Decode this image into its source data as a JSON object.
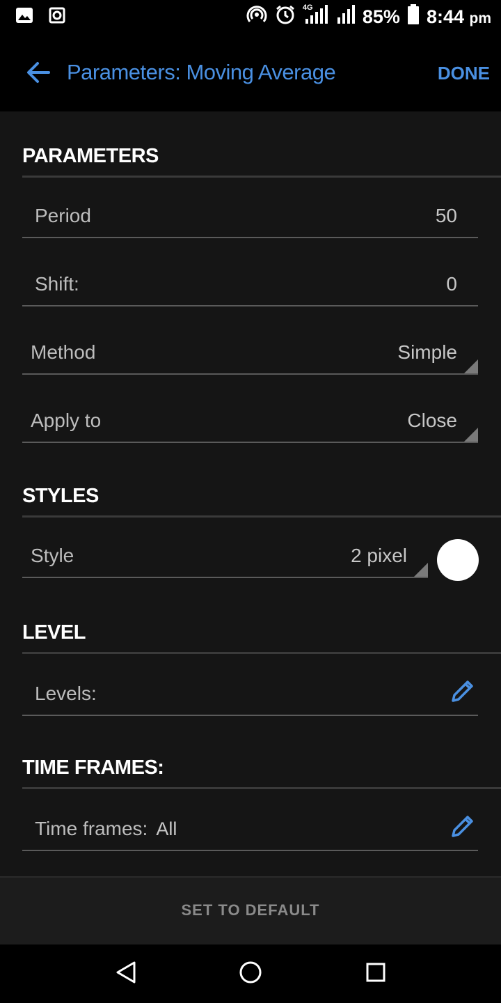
{
  "status": {
    "battery": "85%",
    "time": "8:44",
    "ampm": "pm",
    "network": "4G"
  },
  "appbar": {
    "title": "Parameters: Moving Average",
    "done": "DONE"
  },
  "sections": {
    "parameters": "PARAMETERS",
    "styles": "STYLES",
    "level": "LEVEL",
    "timeframes": "TIME FRAMES:"
  },
  "fields": {
    "period": {
      "label": "Period",
      "value": "50"
    },
    "shift": {
      "label": "Shift:",
      "value": "0"
    },
    "method": {
      "label": "Method",
      "value": "Simple"
    },
    "apply_to": {
      "label": "Apply to",
      "value": "Close"
    },
    "style": {
      "label": "Style",
      "value": "2 pixel",
      "color": "#ffffff"
    },
    "levels": {
      "label": "Levels:"
    },
    "time_frames": {
      "label": "Time frames:",
      "value": "All"
    }
  },
  "footer": {
    "set_default": "SET TO DEFAULT"
  },
  "colors": {
    "accent": "#4a90e2",
    "background": "#151515"
  },
  "icons": [
    "image-icon",
    "screenshot-icon",
    "hotspot-icon",
    "alarm-icon",
    "signal-icon",
    "battery-icon",
    "back-arrow-icon",
    "pencil-icon",
    "nav-back-icon",
    "nav-home-icon",
    "nav-recents-icon"
  ]
}
